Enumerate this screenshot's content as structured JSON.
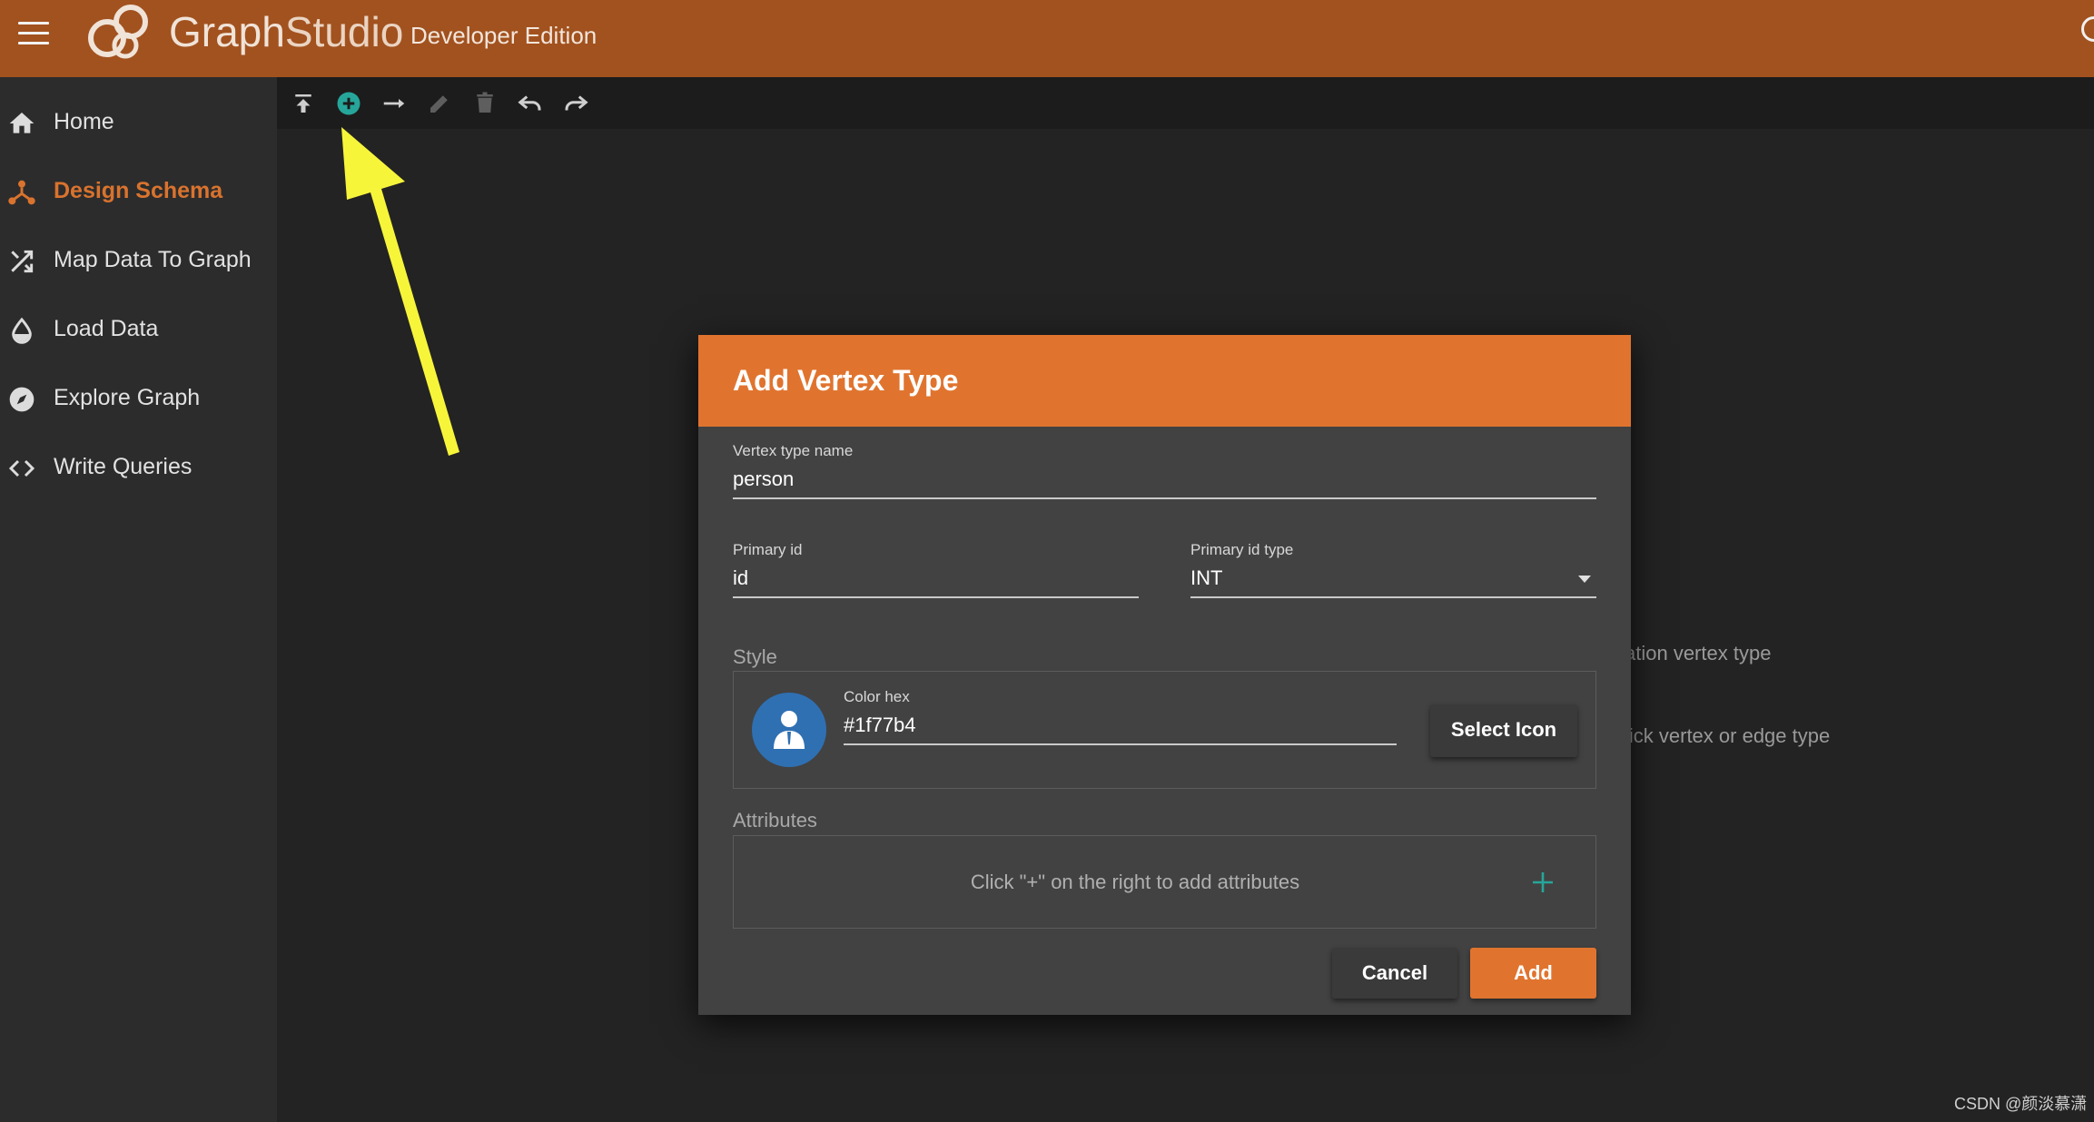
{
  "app": {
    "brand_left": "Graph",
    "brand_right": "Studio",
    "edition": "Developer Edition"
  },
  "sidebar": {
    "items": [
      {
        "label": "Home",
        "icon": "home-icon"
      },
      {
        "label": "Design Schema",
        "icon": "schema-icon",
        "active": true
      },
      {
        "label": "Map Data To Graph",
        "icon": "shuffle-icon"
      },
      {
        "label": "Load Data",
        "icon": "drop-icon"
      },
      {
        "label": "Explore Graph",
        "icon": "compass-icon"
      },
      {
        "label": "Write Queries",
        "icon": "code-icon"
      }
    ]
  },
  "toolbar": {
    "tools": [
      "publish-icon",
      "add-vertex-icon",
      "add-edge-icon",
      "edit-icon",
      "delete-icon",
      "undo-icon",
      "redo-icon"
    ]
  },
  "canvas": {
    "hint_1": "ation vertex type",
    "hint_2": "lick vertex or edge type"
  },
  "dialog": {
    "title": "Add Vertex Type",
    "vertex_name_label": "Vertex type name",
    "vertex_name_value": "person",
    "primary_id_label": "Primary id",
    "primary_id_value": "id",
    "primary_id_type_label": "Primary id type",
    "primary_id_type_value": "INT",
    "style_label": "Style",
    "color_hex_label": "Color hex",
    "color_hex_value": "#1f77b4",
    "select_icon_label": "Select Icon",
    "attributes_label": "Attributes",
    "attributes_empty": "Click \"+\" on the right to add attributes",
    "cancel_label": "Cancel",
    "add_label": "Add"
  },
  "colors": {
    "topbar": "#a2521f",
    "accent": "#e0742f",
    "vertex_color": "#1f77b4",
    "add_attribute_plus": "#26a69a",
    "annotation_arrow": "#f7f53a"
  },
  "watermark": "CSDN @颜淡慕潇"
}
